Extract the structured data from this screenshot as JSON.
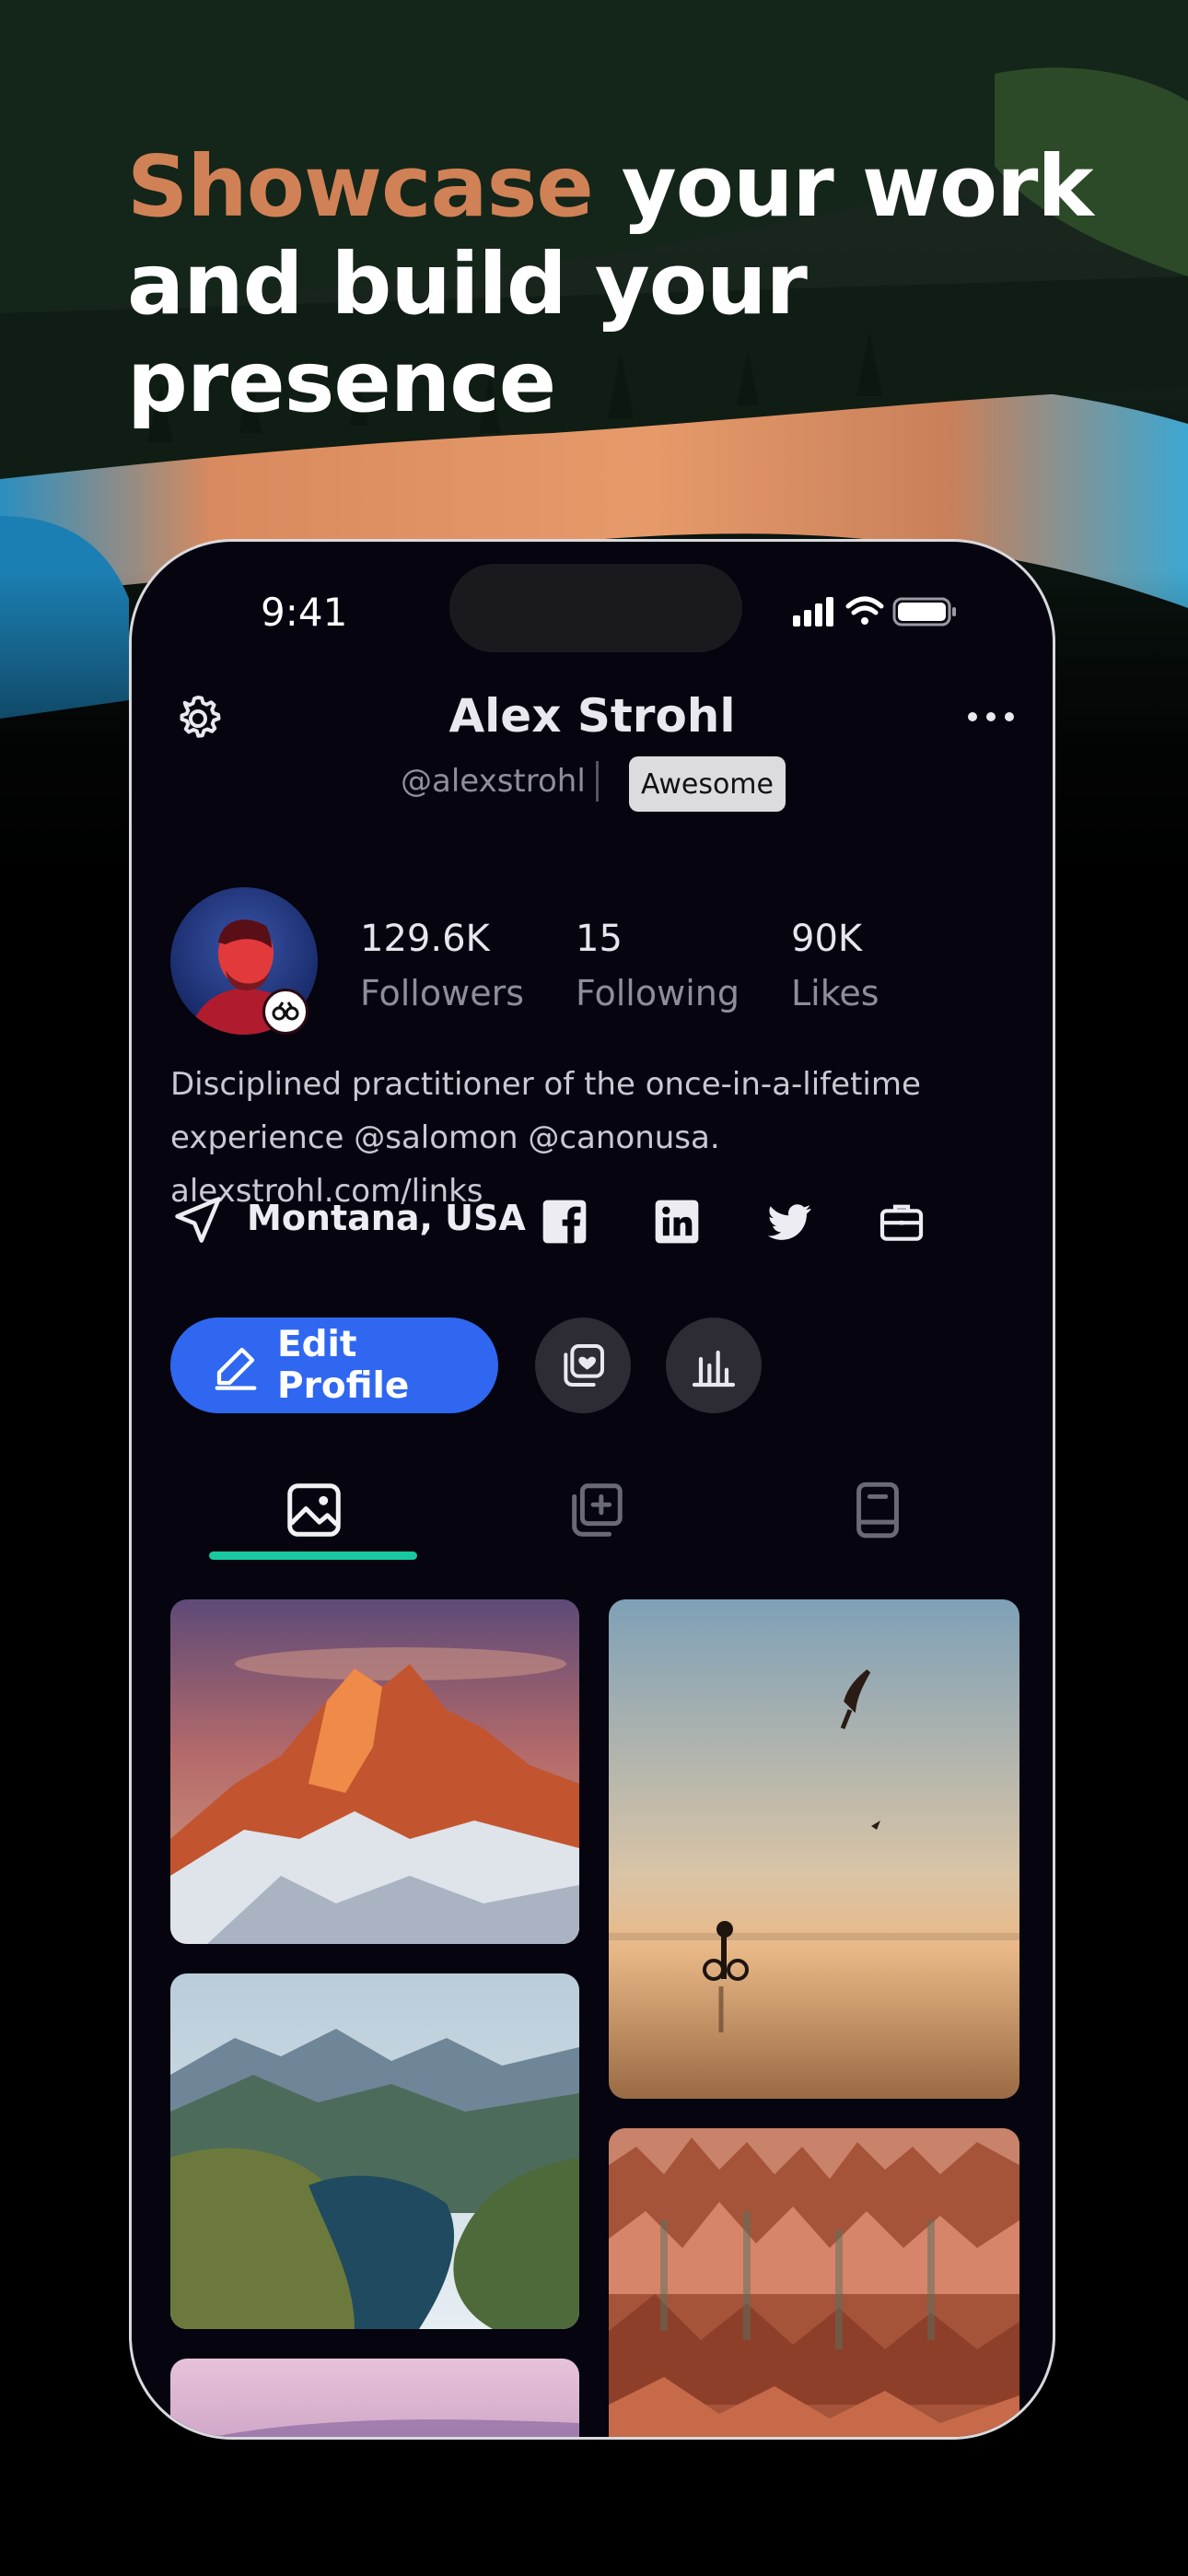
{
  "headline": {
    "accent": "Showcase",
    "line1_rest": " your work",
    "line2": "and build your presence"
  },
  "status_bar": {
    "time": "9:41",
    "icons": [
      "cellular-signal-icon",
      "wifi-icon",
      "battery-icon"
    ]
  },
  "profile": {
    "name": "Alex Strohl",
    "handle": "@alexstrohl",
    "badge": "Awesome",
    "stats": [
      {
        "value": "129.6K",
        "label": "Followers"
      },
      {
        "value": "15",
        "label": "Following"
      },
      {
        "value": "90K",
        "label": "Likes"
      }
    ],
    "bio_line1": "Disciplined practitioner of the once-in-a-lifetime",
    "bio_line2": "experience @salomon @canonusa. alexstrohl.com/links",
    "location": "Montana, USA",
    "social_icons": [
      "facebook-icon",
      "linkedin-icon",
      "twitter-icon",
      "briefcase-icon"
    ]
  },
  "actions": {
    "edit_profile": "Edit Profile"
  },
  "tabs": [
    "photos-tab",
    "collections-tab",
    "journal-tab"
  ],
  "active_tab": "photos-tab",
  "colors": {
    "accent_orange": "#d08156",
    "primary_blue": "#2f67f1",
    "tab_indicator": "#19c8a0",
    "phone_background": "#05040f"
  },
  "gallery": [
    "alpenglow-mountain-photo",
    "beach-motorcycle-birds-photo",
    "mountain-lake-valley-photo",
    "red-canyon-hoodoos-photo",
    "pink-sky-photo"
  ]
}
